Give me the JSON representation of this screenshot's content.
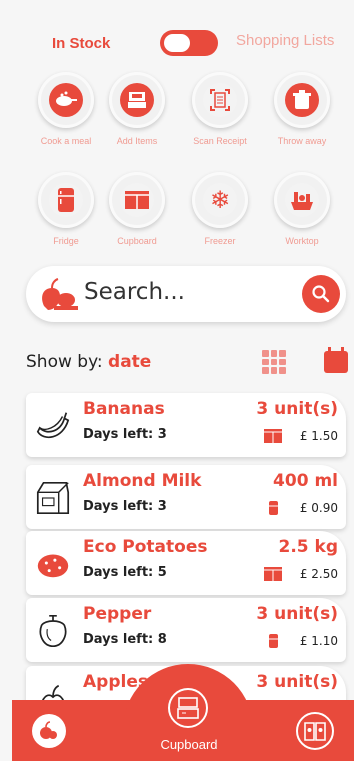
{
  "header": {
    "tab_in_stock": "In Stock",
    "tab_shopping_lists": "Shopping Lists"
  },
  "actions": [
    {
      "label": "Cook a meal",
      "icon": "pan-icon"
    },
    {
      "label": "Add Items",
      "icon": "register-icon"
    },
    {
      "label": "Scan Receipt",
      "icon": "receipt-icon"
    },
    {
      "label": "Throw away",
      "icon": "bin-icon"
    },
    {
      "label": "Fridge",
      "icon": "fridge-icon"
    },
    {
      "label": "Cupboard",
      "icon": "cupboard-icon"
    },
    {
      "label": "Freezer",
      "icon": "snowflake-icon"
    },
    {
      "label": "Worktop",
      "icon": "worktop-icon"
    }
  ],
  "search": {
    "placeholder": "Search..."
  },
  "show_by": {
    "prefix": "Show by:",
    "value": "date"
  },
  "items": [
    {
      "name": "Bananas",
      "days": "Days left: 3",
      "qty": "3 unit(s)",
      "price": "£ 1.50",
      "location": "cupboard"
    },
    {
      "name": "Almond Milk",
      "days": "Days left: 3",
      "qty": "400 ml",
      "price": "£ 0.90",
      "location": "fridge"
    },
    {
      "name": "Eco Potatoes",
      "days": "Days left: 5",
      "qty": "2.5 kg",
      "price": "£ 2.50",
      "location": "cupboard"
    },
    {
      "name": "Pepper",
      "days": "Days left: 8",
      "qty": "3 unit(s)",
      "price": "£ 1.10",
      "location": "fridge"
    },
    {
      "name": "Apples",
      "days": "",
      "qty": "3 unit(s)",
      "price": "",
      "location": ""
    }
  ],
  "bottom_nav": {
    "center_label": "Cupboard"
  },
  "colors": {
    "accent": "#e84a3c",
    "muted_accent": "#f09b92",
    "background": "#f6f6f6"
  }
}
